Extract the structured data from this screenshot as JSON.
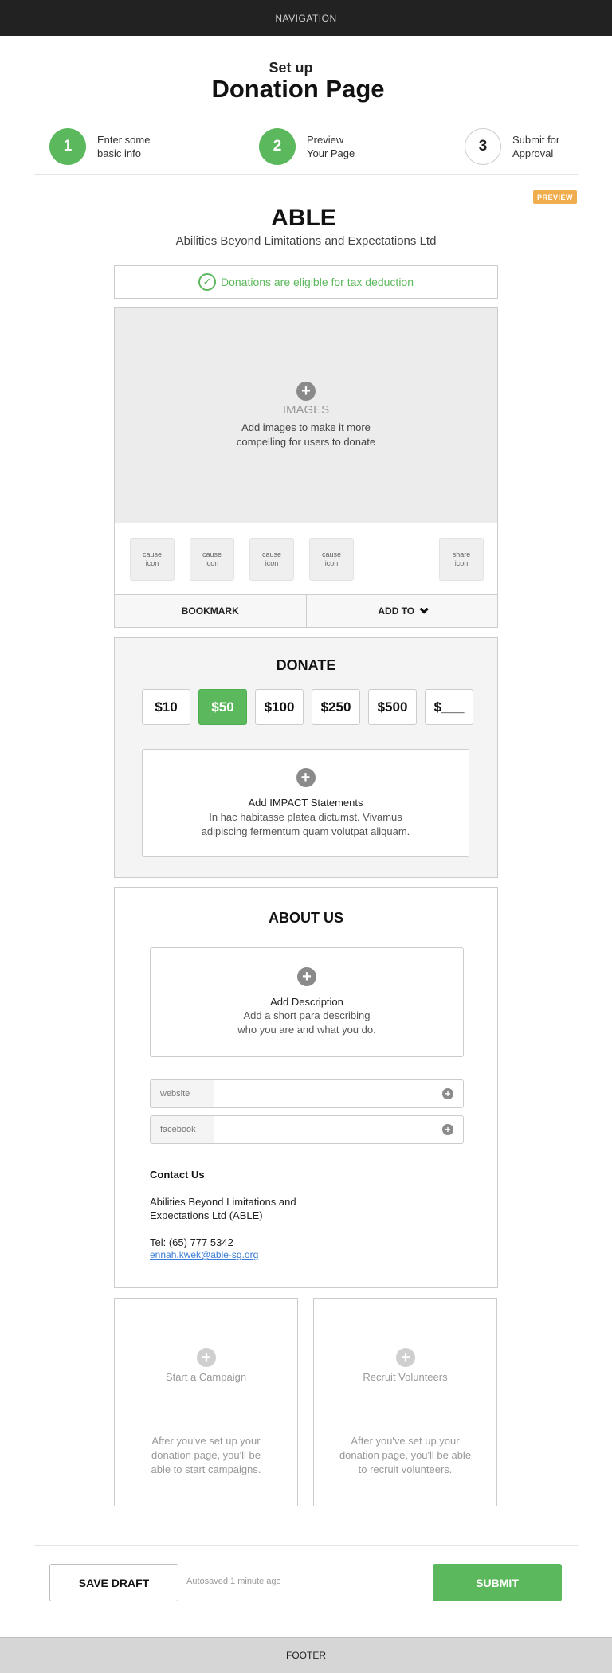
{
  "nav": {
    "label": "NAVIGATION"
  },
  "header": {
    "subtitle": "Set up",
    "title": "Donation Page"
  },
  "steps": [
    {
      "number": "1",
      "label": "Enter some\nbasic info",
      "state": "complete"
    },
    {
      "number": "2",
      "label": "Preview\nYour Page",
      "state": "complete"
    },
    {
      "number": "3",
      "label": "Submit for\nApproval",
      "state": "pending"
    }
  ],
  "preview_badge": "PREVIEW",
  "org": {
    "name": "ABLE",
    "full_name": "Abilities Beyond Limitations and Expectations Ltd"
  },
  "tax_notice": "Donations are eligible for tax deduction",
  "images": {
    "title": "IMAGES",
    "description": "Add images to make it more\ncompelling for users to donate"
  },
  "icons": {
    "cause": [
      "cause\nicon",
      "cause\nicon",
      "cause\nicon",
      "cause\nicon"
    ],
    "share": "share\nicon"
  },
  "actions": {
    "bookmark": "BOOKMARK",
    "add_to": "ADD TO"
  },
  "donate": {
    "title": "DONATE",
    "amounts": [
      "$10",
      "$50",
      "$100",
      "$250",
      "$500",
      "$___"
    ],
    "selected_amount": "$50",
    "impact_title": "Add IMPACT Statements",
    "impact_desc": "In hac habitasse platea dictumst. Vivamus\nadipiscing fermentum quam volutpat aliquam."
  },
  "about": {
    "title": "ABOUT US",
    "desc_title": "Add Description",
    "desc_text": "Add a short para describing\nwho you are and what you do.",
    "links": [
      {
        "label": "website",
        "value": ""
      },
      {
        "label": "facebook",
        "value": ""
      }
    ],
    "contact_title": "Contact Us",
    "contact_org": "Abilities Beyond Limitations and\nExpectations Ltd (ABLE)",
    "contact_tel": "Tel: (65) 777 5342",
    "contact_email": "ennah.kwek@able-sg.org"
  },
  "cta": {
    "campaign_title": "Start a Campaign",
    "campaign_desc": "After you've set up your\ndonation page, you'll be\nable to start campaigns.",
    "volunteers_title": "Recruit Volunteers",
    "volunteers_desc": "After you've set up your\ndonation page, you'll be able\nto recruit volunteers."
  },
  "bottom_bar": {
    "save_label": "SAVE DRAFT",
    "autosaved": "Autosaved 1 minute ago",
    "submit_label": "SUBMIT"
  },
  "footer": {
    "label": "FOOTER"
  },
  "colors": {
    "accent_green": "#5cb85c",
    "preview_orange": "#f0ad4e",
    "nav_dark": "#222222",
    "link_blue": "#3a7bd5"
  }
}
